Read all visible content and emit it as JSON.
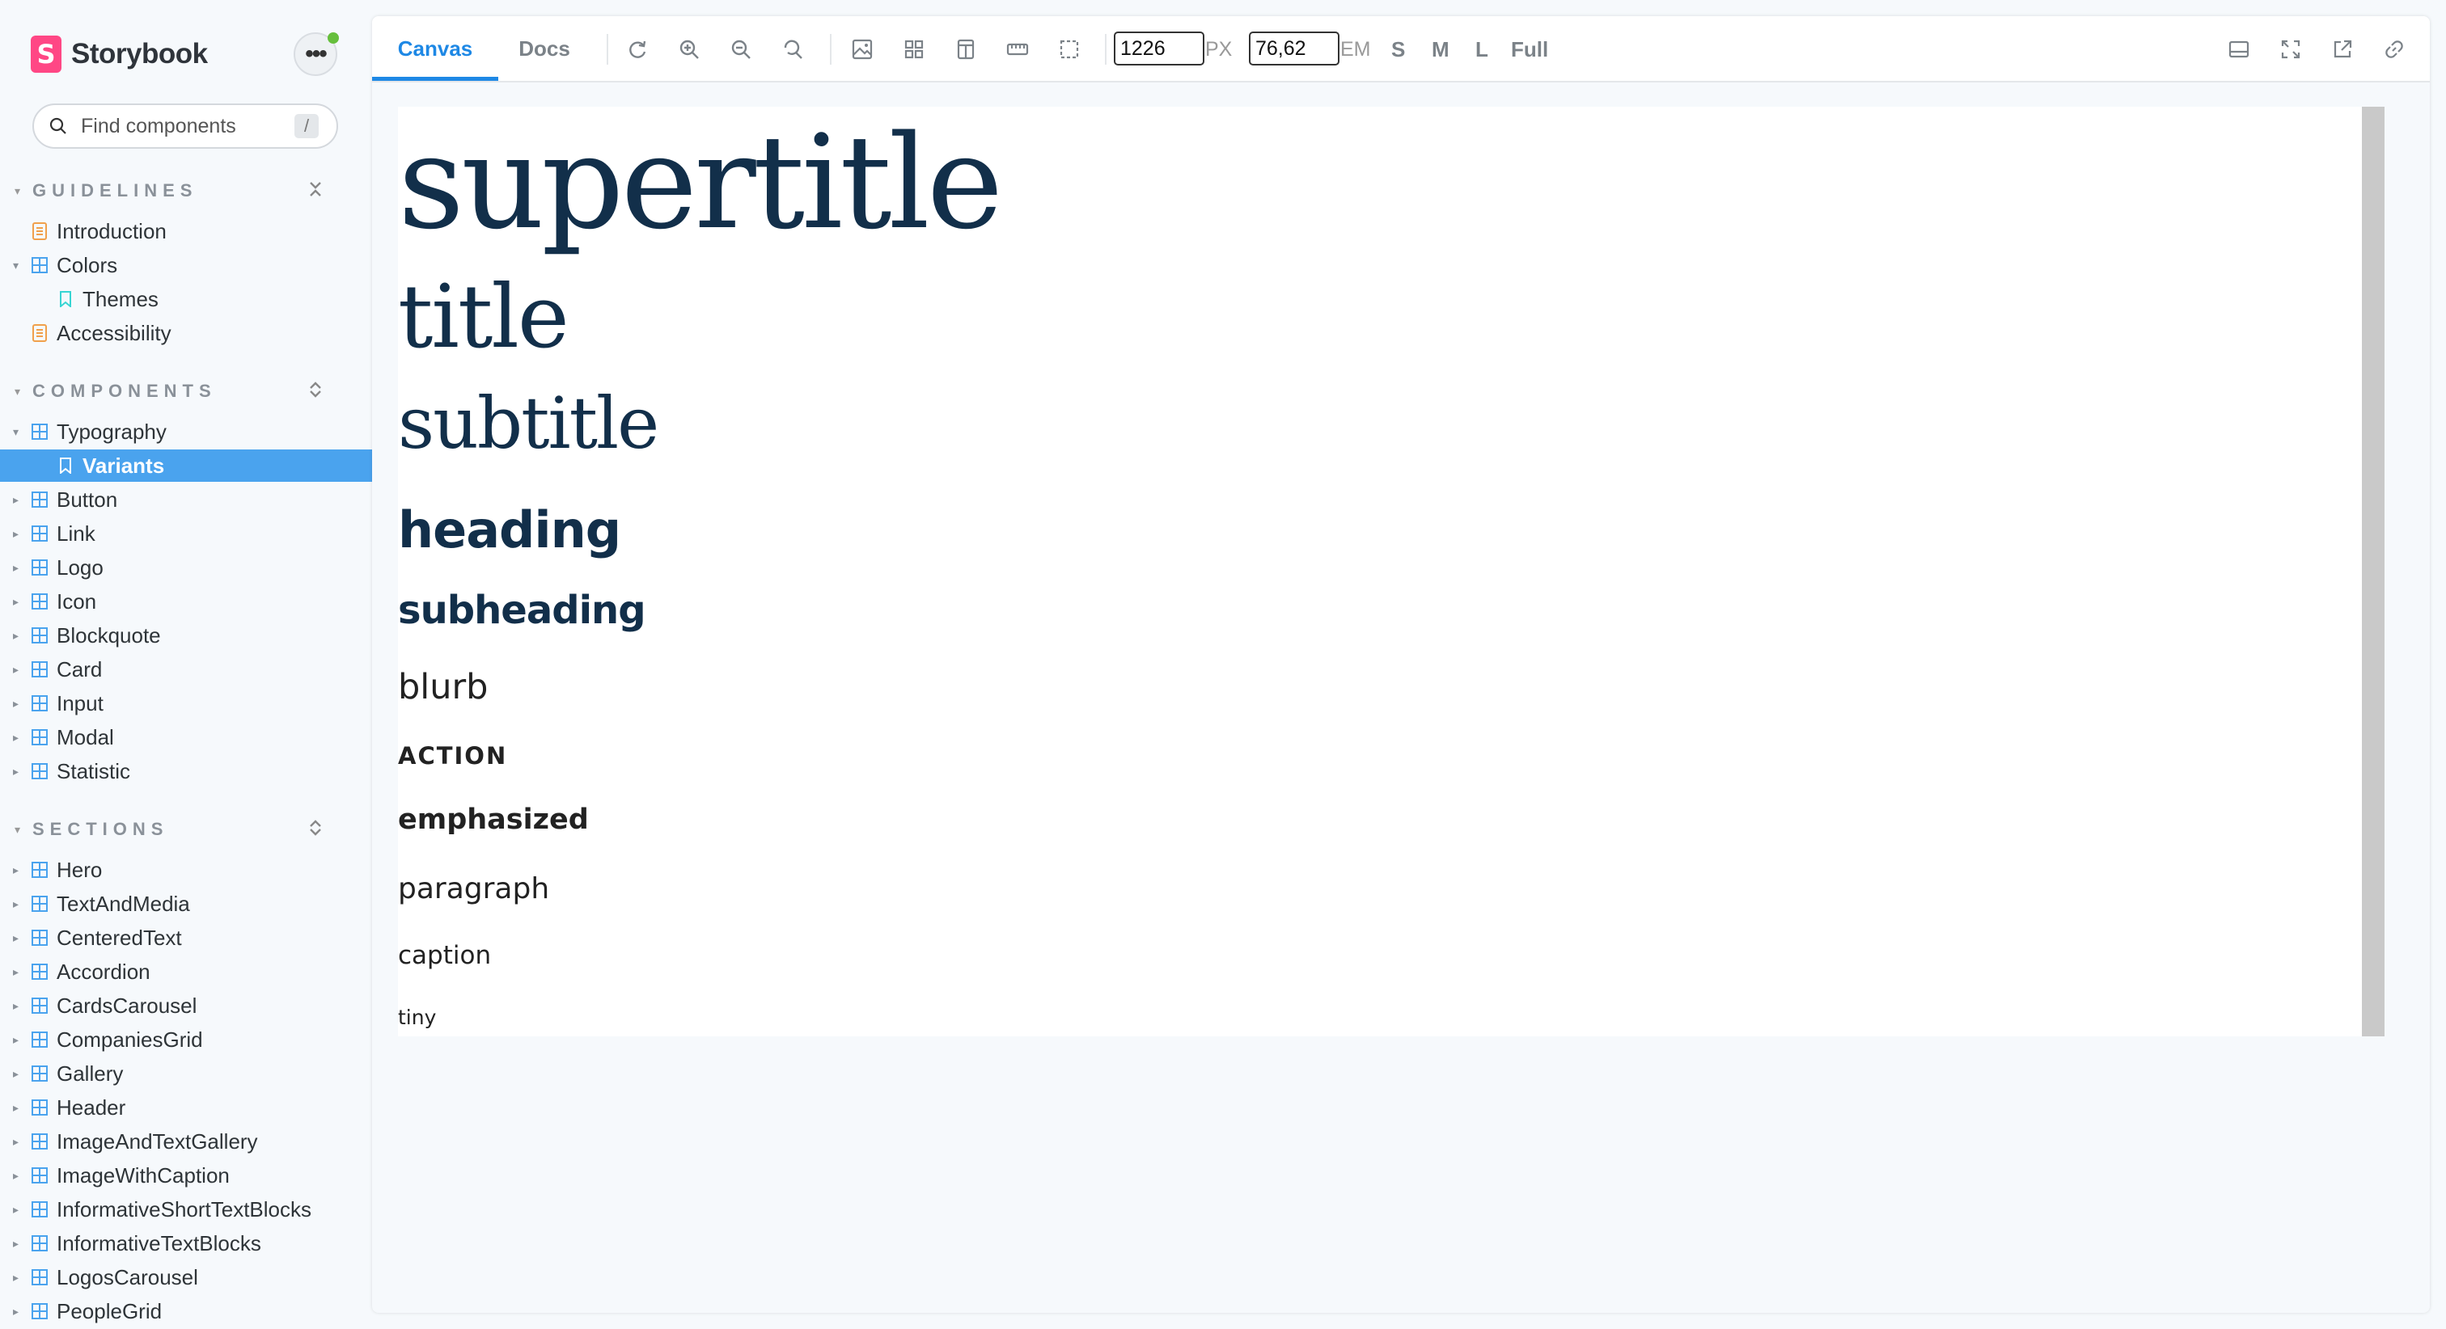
{
  "brand": {
    "name": "Storybook",
    "logo_letter": "S"
  },
  "search": {
    "placeholder": "Find components",
    "shortcut": "/"
  },
  "sections": [
    {
      "label": "GUIDELINES"
    },
    {
      "label": "COMPONENTS"
    },
    {
      "label": "SECTIONS"
    }
  ],
  "guidelines": [
    "Introduction",
    "Colors",
    "Themes",
    "Accessibility"
  ],
  "components": [
    "Typography",
    "Variants",
    "Button",
    "Link",
    "Logo",
    "Icon",
    "Blockquote",
    "Card",
    "Input",
    "Modal",
    "Statistic"
  ],
  "sections_items": [
    "Hero",
    "TextAndMedia",
    "CenteredText",
    "Accordion",
    "CardsCarousel",
    "CompaniesGrid",
    "Gallery",
    "Header",
    "ImageAndTextGallery",
    "ImageWithCaption",
    "InformativeShortTextBlocks",
    "InformativeTextBlocks",
    "LogosCarousel",
    "PeopleGrid"
  ],
  "toolbar": {
    "tab_canvas": "Canvas",
    "tab_docs": "Docs",
    "width_value": "1226",
    "width_unit": "PX",
    "em_value": "76,62",
    "em_unit": "EM",
    "size_s": "S",
    "size_m": "M",
    "size_l": "L",
    "size_full": "Full"
  },
  "variants": {
    "supertitle": "supertitle",
    "title": "title",
    "subtitle": "subtitle",
    "heading": "heading",
    "subheading": "subheading",
    "blurb": "blurb",
    "action": "ACTION",
    "emphasized": "emphasized",
    "paragraph": "paragraph",
    "caption": "caption",
    "tiny": "tiny"
  },
  "colors": {
    "accent": "#1e88e5",
    "selected_bg": "#4aa3ee",
    "brand_pink": "#ff4785",
    "typography_navy": "#122f4a",
    "status_green": "#66bf3c"
  }
}
